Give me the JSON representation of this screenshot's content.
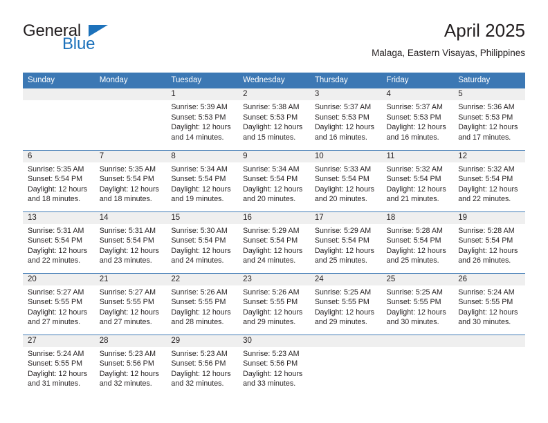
{
  "logo": {
    "text_primary": "General",
    "text_secondary": "Blue",
    "primary_color": "#231f20",
    "secondary_color": "#1d72bb"
  },
  "header": {
    "title": "April 2025",
    "subtitle": "Malaga, Eastern Visayas, Philippines"
  },
  "theme": {
    "header_blue": "#3c78b4",
    "daynum_band": "#efefef",
    "text": "#231f20"
  },
  "weekday_headers": [
    "Sunday",
    "Monday",
    "Tuesday",
    "Wednesday",
    "Thursday",
    "Friday",
    "Saturday"
  ],
  "labels": {
    "sunrise": "Sunrise:",
    "sunset": "Sunset:",
    "daylight": "Daylight:"
  },
  "weeks": [
    [
      {
        "day": ""
      },
      {
        "day": ""
      },
      {
        "day": "1",
        "sunrise": "Sunrise: 5:39 AM",
        "sunset": "Sunset: 5:53 PM",
        "daylight_1": "Daylight: 12 hours",
        "daylight_2": "and 14 minutes."
      },
      {
        "day": "2",
        "sunrise": "Sunrise: 5:38 AM",
        "sunset": "Sunset: 5:53 PM",
        "daylight_1": "Daylight: 12 hours",
        "daylight_2": "and 15 minutes."
      },
      {
        "day": "3",
        "sunrise": "Sunrise: 5:37 AM",
        "sunset": "Sunset: 5:53 PM",
        "daylight_1": "Daylight: 12 hours",
        "daylight_2": "and 16 minutes."
      },
      {
        "day": "4",
        "sunrise": "Sunrise: 5:37 AM",
        "sunset": "Sunset: 5:53 PM",
        "daylight_1": "Daylight: 12 hours",
        "daylight_2": "and 16 minutes."
      },
      {
        "day": "5",
        "sunrise": "Sunrise: 5:36 AM",
        "sunset": "Sunset: 5:53 PM",
        "daylight_1": "Daylight: 12 hours",
        "daylight_2": "and 17 minutes."
      }
    ],
    [
      {
        "day": "6",
        "sunrise": "Sunrise: 5:35 AM",
        "sunset": "Sunset: 5:54 PM",
        "daylight_1": "Daylight: 12 hours",
        "daylight_2": "and 18 minutes."
      },
      {
        "day": "7",
        "sunrise": "Sunrise: 5:35 AM",
        "sunset": "Sunset: 5:54 PM",
        "daylight_1": "Daylight: 12 hours",
        "daylight_2": "and 18 minutes."
      },
      {
        "day": "8",
        "sunrise": "Sunrise: 5:34 AM",
        "sunset": "Sunset: 5:54 PM",
        "daylight_1": "Daylight: 12 hours",
        "daylight_2": "and 19 minutes."
      },
      {
        "day": "9",
        "sunrise": "Sunrise: 5:34 AM",
        "sunset": "Sunset: 5:54 PM",
        "daylight_1": "Daylight: 12 hours",
        "daylight_2": "and 20 minutes."
      },
      {
        "day": "10",
        "sunrise": "Sunrise: 5:33 AM",
        "sunset": "Sunset: 5:54 PM",
        "daylight_1": "Daylight: 12 hours",
        "daylight_2": "and 20 minutes."
      },
      {
        "day": "11",
        "sunrise": "Sunrise: 5:32 AM",
        "sunset": "Sunset: 5:54 PM",
        "daylight_1": "Daylight: 12 hours",
        "daylight_2": "and 21 minutes."
      },
      {
        "day": "12",
        "sunrise": "Sunrise: 5:32 AM",
        "sunset": "Sunset: 5:54 PM",
        "daylight_1": "Daylight: 12 hours",
        "daylight_2": "and 22 minutes."
      }
    ],
    [
      {
        "day": "13",
        "sunrise": "Sunrise: 5:31 AM",
        "sunset": "Sunset: 5:54 PM",
        "daylight_1": "Daylight: 12 hours",
        "daylight_2": "and 22 minutes."
      },
      {
        "day": "14",
        "sunrise": "Sunrise: 5:31 AM",
        "sunset": "Sunset: 5:54 PM",
        "daylight_1": "Daylight: 12 hours",
        "daylight_2": "and 23 minutes."
      },
      {
        "day": "15",
        "sunrise": "Sunrise: 5:30 AM",
        "sunset": "Sunset: 5:54 PM",
        "daylight_1": "Daylight: 12 hours",
        "daylight_2": "and 24 minutes."
      },
      {
        "day": "16",
        "sunrise": "Sunrise: 5:29 AM",
        "sunset": "Sunset: 5:54 PM",
        "daylight_1": "Daylight: 12 hours",
        "daylight_2": "and 24 minutes."
      },
      {
        "day": "17",
        "sunrise": "Sunrise: 5:29 AM",
        "sunset": "Sunset: 5:54 PM",
        "daylight_1": "Daylight: 12 hours",
        "daylight_2": "and 25 minutes."
      },
      {
        "day": "18",
        "sunrise": "Sunrise: 5:28 AM",
        "sunset": "Sunset: 5:54 PM",
        "daylight_1": "Daylight: 12 hours",
        "daylight_2": "and 25 minutes."
      },
      {
        "day": "19",
        "sunrise": "Sunrise: 5:28 AM",
        "sunset": "Sunset: 5:54 PM",
        "daylight_1": "Daylight: 12 hours",
        "daylight_2": "and 26 minutes."
      }
    ],
    [
      {
        "day": "20",
        "sunrise": "Sunrise: 5:27 AM",
        "sunset": "Sunset: 5:55 PM",
        "daylight_1": "Daylight: 12 hours",
        "daylight_2": "and 27 minutes."
      },
      {
        "day": "21",
        "sunrise": "Sunrise: 5:27 AM",
        "sunset": "Sunset: 5:55 PM",
        "daylight_1": "Daylight: 12 hours",
        "daylight_2": "and 27 minutes."
      },
      {
        "day": "22",
        "sunrise": "Sunrise: 5:26 AM",
        "sunset": "Sunset: 5:55 PM",
        "daylight_1": "Daylight: 12 hours",
        "daylight_2": "and 28 minutes."
      },
      {
        "day": "23",
        "sunrise": "Sunrise: 5:26 AM",
        "sunset": "Sunset: 5:55 PM",
        "daylight_1": "Daylight: 12 hours",
        "daylight_2": "and 29 minutes."
      },
      {
        "day": "24",
        "sunrise": "Sunrise: 5:25 AM",
        "sunset": "Sunset: 5:55 PM",
        "daylight_1": "Daylight: 12 hours",
        "daylight_2": "and 29 minutes."
      },
      {
        "day": "25",
        "sunrise": "Sunrise: 5:25 AM",
        "sunset": "Sunset: 5:55 PM",
        "daylight_1": "Daylight: 12 hours",
        "daylight_2": "and 30 minutes."
      },
      {
        "day": "26",
        "sunrise": "Sunrise: 5:24 AM",
        "sunset": "Sunset: 5:55 PM",
        "daylight_1": "Daylight: 12 hours",
        "daylight_2": "and 30 minutes."
      }
    ],
    [
      {
        "day": "27",
        "sunrise": "Sunrise: 5:24 AM",
        "sunset": "Sunset: 5:55 PM",
        "daylight_1": "Daylight: 12 hours",
        "daylight_2": "and 31 minutes."
      },
      {
        "day": "28",
        "sunrise": "Sunrise: 5:23 AM",
        "sunset": "Sunset: 5:56 PM",
        "daylight_1": "Daylight: 12 hours",
        "daylight_2": "and 32 minutes."
      },
      {
        "day": "29",
        "sunrise": "Sunrise: 5:23 AM",
        "sunset": "Sunset: 5:56 PM",
        "daylight_1": "Daylight: 12 hours",
        "daylight_2": "and 32 minutes."
      },
      {
        "day": "30",
        "sunrise": "Sunrise: 5:23 AM",
        "sunset": "Sunset: 5:56 PM",
        "daylight_1": "Daylight: 12 hours",
        "daylight_2": "and 33 minutes."
      },
      {
        "day": ""
      },
      {
        "day": ""
      },
      {
        "day": ""
      }
    ]
  ]
}
